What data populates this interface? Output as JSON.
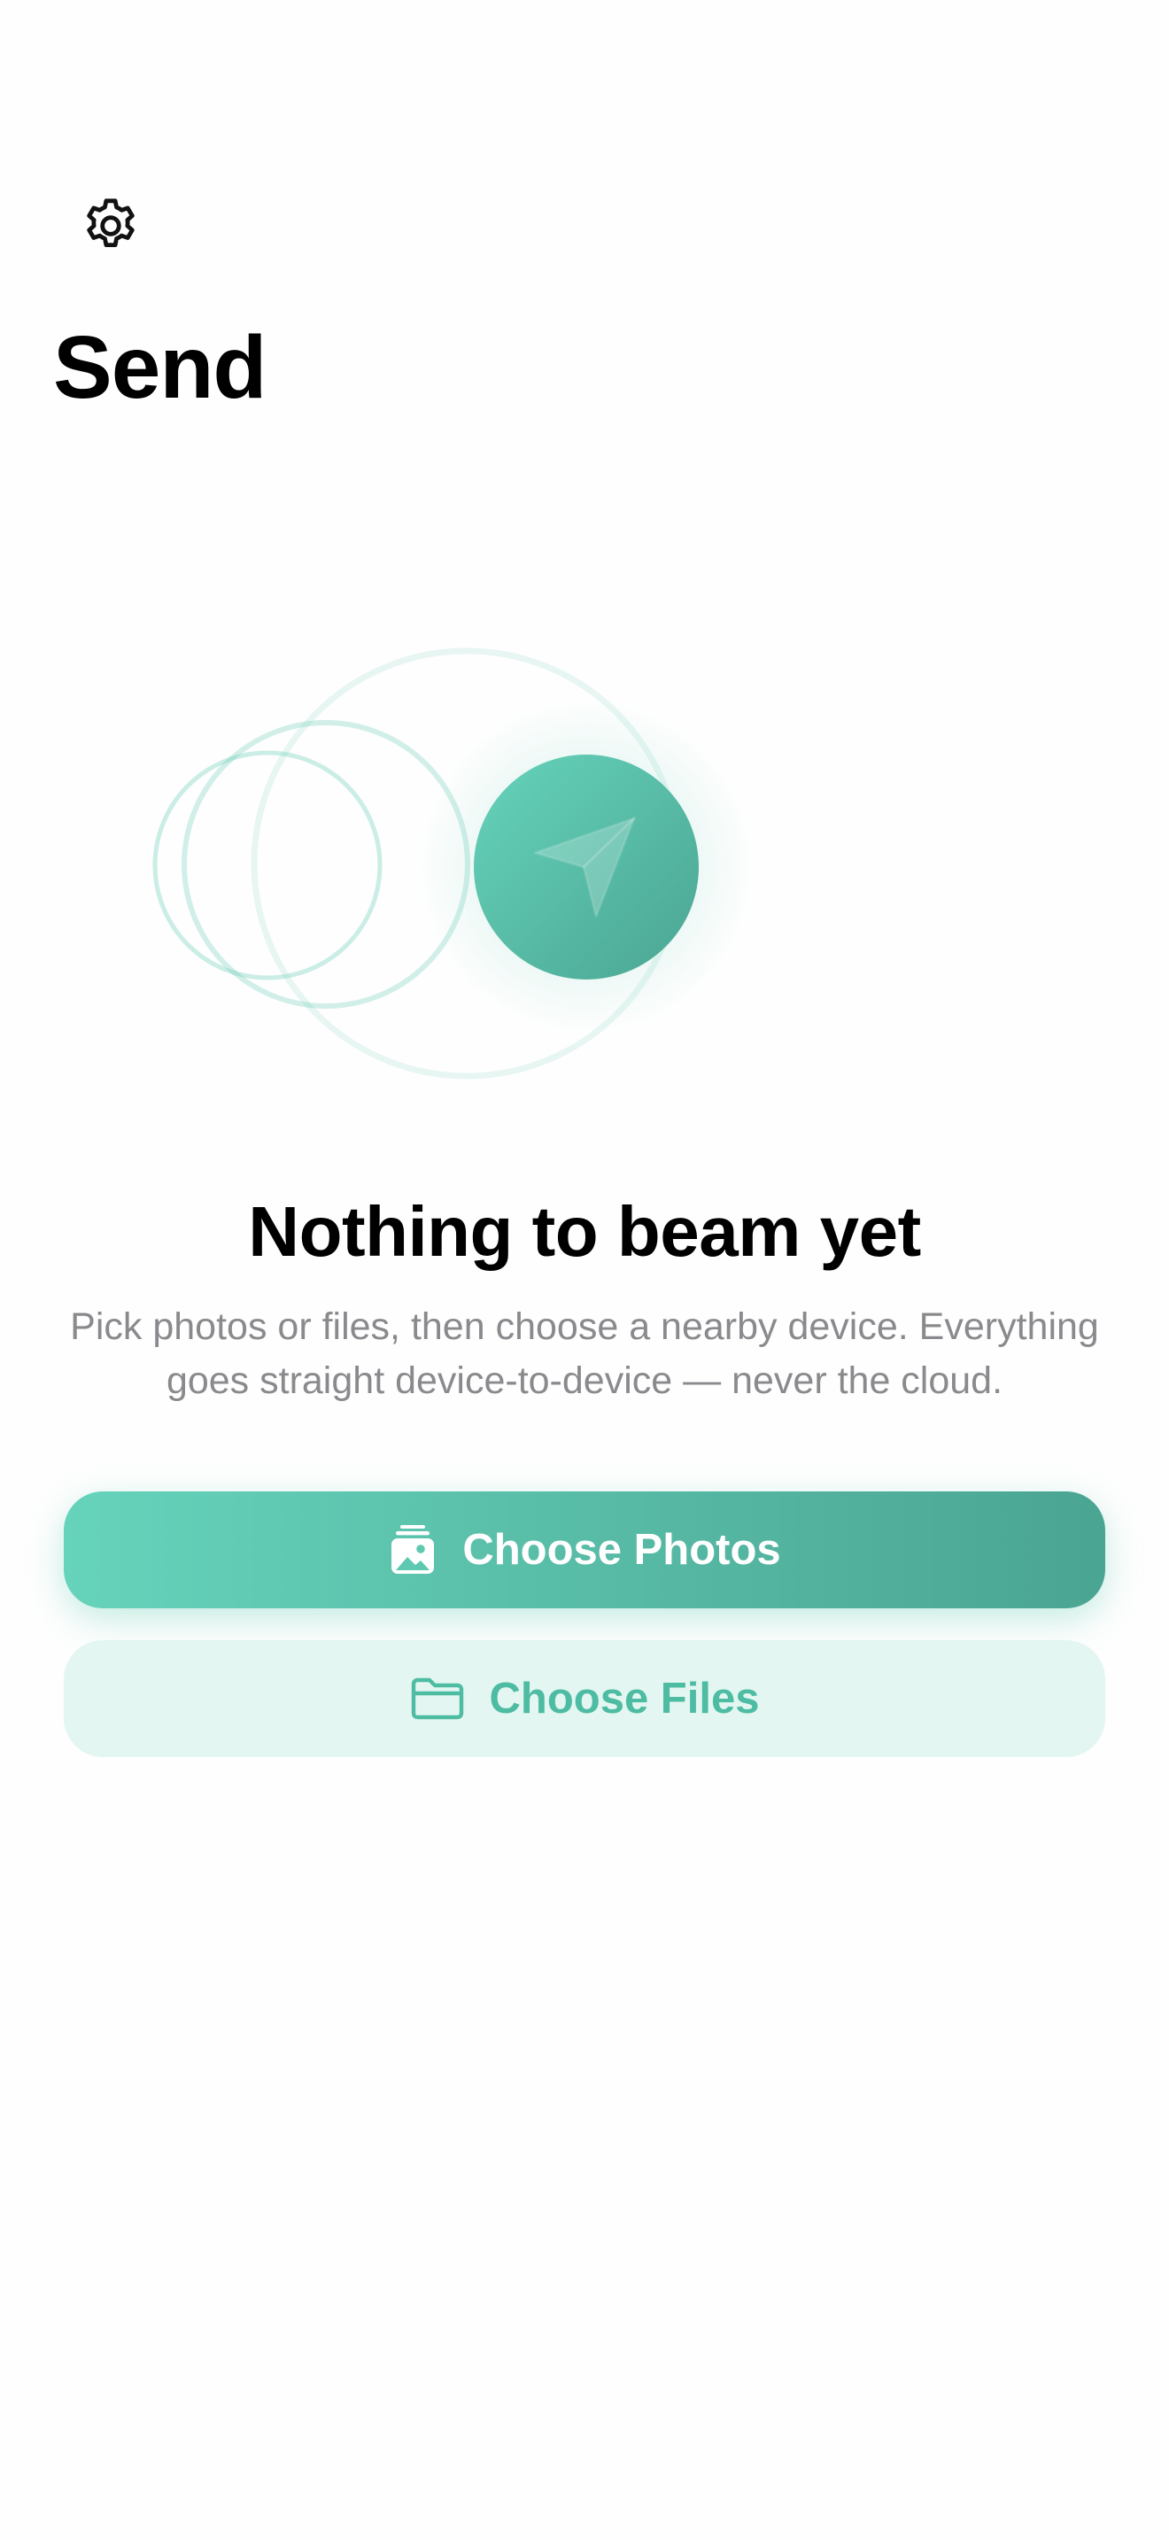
{
  "header": {
    "title": "Send",
    "settings_icon": "gear-icon"
  },
  "empty_state": {
    "illustration_icon": "paper-plane-icon",
    "title": "Nothing to beam yet",
    "description": "Pick photos or files, then choose a nearby device. Everything goes straight device-to-device — never the cloud."
  },
  "actions": {
    "choose_photos_label": "Choose Photos",
    "choose_photos_icon": "photos-stack-icon",
    "choose_files_label": "Choose Files",
    "choose_files_icon": "folder-icon"
  },
  "colors": {
    "accent": "#5ec9b0",
    "accent_dark": "#4aa592",
    "accent_light_bg": "#e3f6f1",
    "secondary_text": "#8a8a8e",
    "title_text": "#000000"
  }
}
